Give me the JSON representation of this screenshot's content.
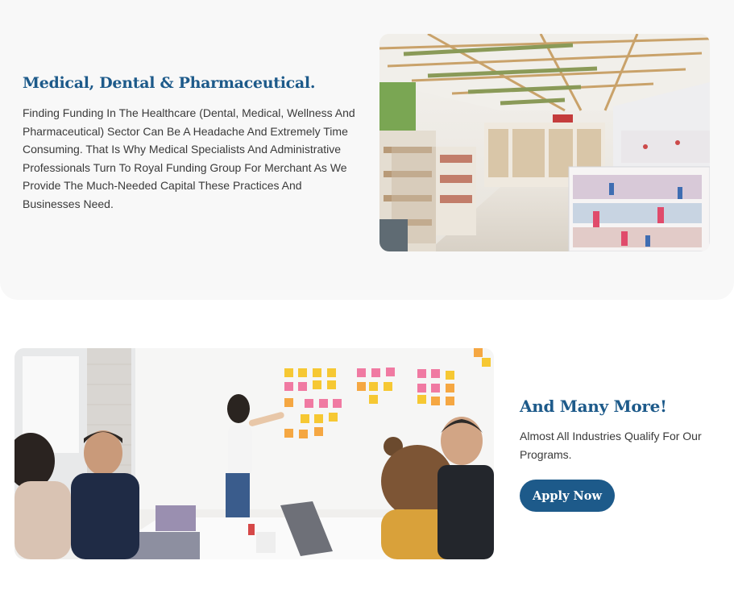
{
  "medical": {
    "title": "Medical, Dental & Pharmaceutical.",
    "body": "Finding Funding In The Healthcare (Dental, Medical, Wellness And Pharmaceutical) Sector Can Be A Headache And Extremely Time Consuming. That Is Why Medical Specialists And Administrative Professionals Turn To Royal Funding Group For Merchant As We Provide The Much-Needed Capital These Practices And Businesses Need."
  },
  "more": {
    "title": "And Many More!",
    "body": "Almost All Industries Qualify For Our Programs.",
    "button_label": "Apply Now"
  },
  "colors": {
    "accent": "#1d5a8a",
    "section_bg": "#f8f8f8",
    "text": "#3a3a3a"
  }
}
